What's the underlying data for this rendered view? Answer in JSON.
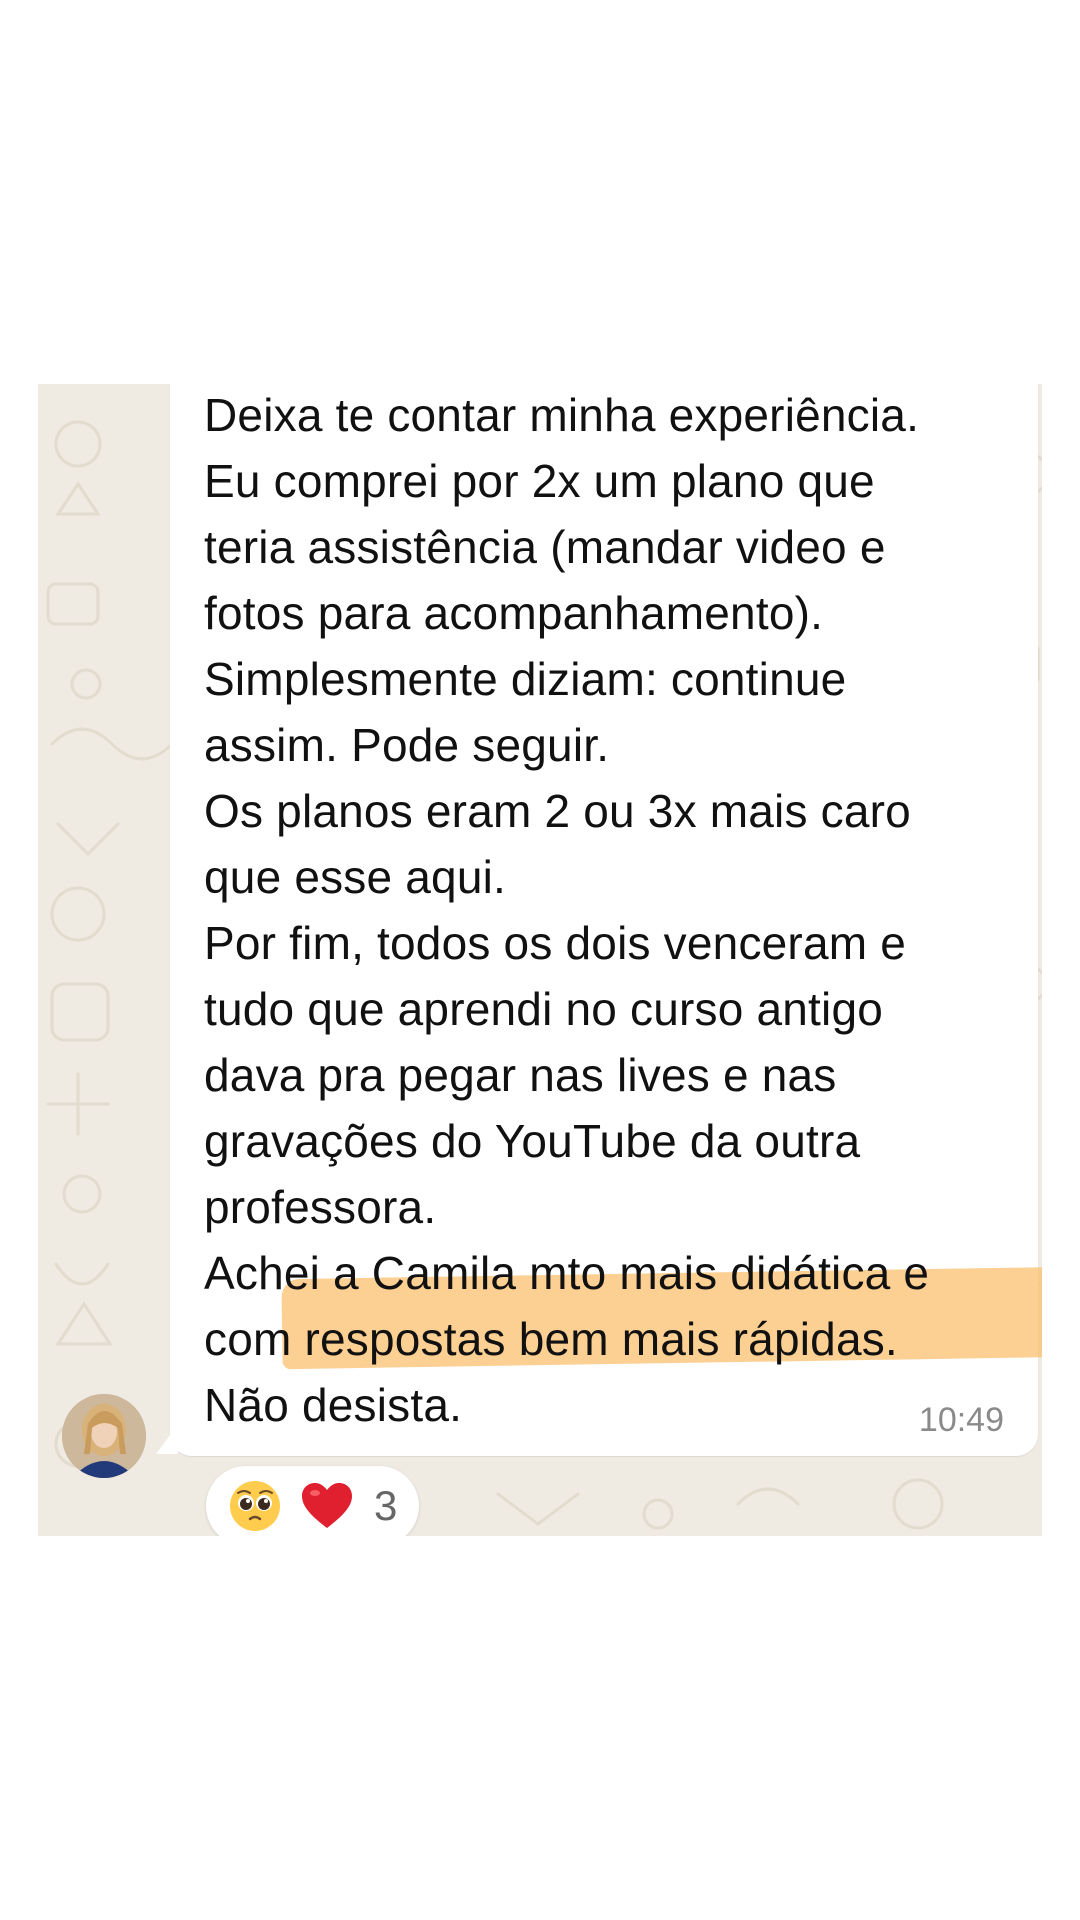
{
  "message": {
    "lines": [
      "Deixa te contar minha experiência.",
      "Eu comprei por 2x um plano que",
      "teria assistência (mandar video e",
      "fotos para acompanhamento).",
      "Simplesmente diziam: continue",
      "assim. Pode seguir.",
      "Os planos eram 2 ou 3x mais caro",
      "que esse aqui.",
      "Por fim, todos os dois venceram e",
      "tudo que aprendi no curso antigo",
      "dava pra pegar nas lives e nas",
      "gravações do YouTube da outra",
      "professora.",
      "Achei a Camila mto mais didática e",
      "com respostas bem mais rápidas.",
      "Não desista."
    ],
    "time": "10:49"
  },
  "reactions": {
    "emojis": [
      "pleading-face-icon",
      "red-heart-icon"
    ],
    "count": "3"
  },
  "colors": {
    "chat_background": "#efeae2",
    "bubble": "#ffffff",
    "highlight": "#fbbf6e",
    "timestamp": "#8a8a8a"
  }
}
